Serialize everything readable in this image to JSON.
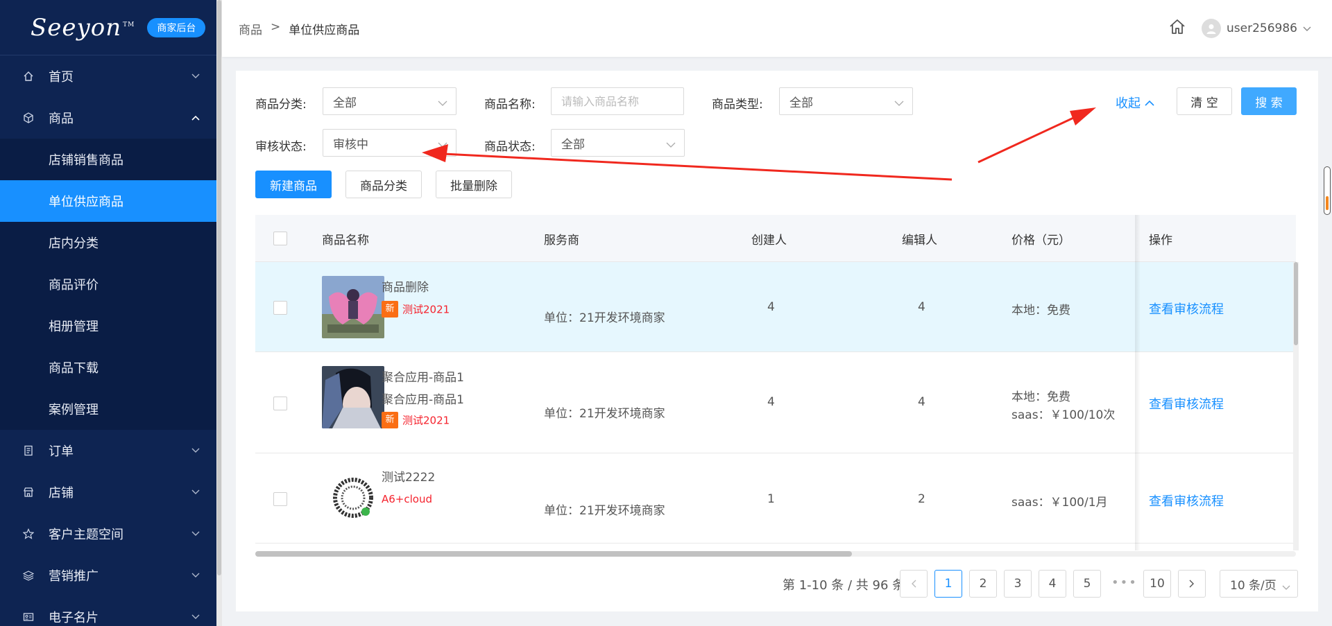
{
  "sidebar": {
    "brand": "Seeyon",
    "brand_tm": "TM",
    "badge": "商家后台",
    "items": [
      {
        "label": "首页",
        "icon": "home-icon"
      },
      {
        "label": "商品",
        "icon": "cube-icon"
      },
      {
        "label": "订单",
        "icon": "order-icon"
      },
      {
        "label": "店铺",
        "icon": "store-icon"
      },
      {
        "label": "客户主题空间",
        "icon": "star-icon"
      },
      {
        "label": "营销推广",
        "icon": "layers-icon"
      },
      {
        "label": "电子名片",
        "icon": "card-icon"
      }
    ],
    "sub_items": [
      "店铺销售商品",
      "单位供应商品",
      "店内分类",
      "商品评价",
      "相册管理",
      "商品下载",
      "案例管理"
    ],
    "active_sub": "单位供应商品"
  },
  "header": {
    "breadcrumb": [
      "商品",
      ">",
      "单位供应商品"
    ],
    "username": "user256986"
  },
  "filters": {
    "category_label": "商品分类:",
    "category_value": "全部",
    "name_label": "商品名称:",
    "name_placeholder": "请输入商品名称",
    "type_label": "商品类型:",
    "type_value": "全部",
    "audit_label": "审核状态:",
    "audit_value": "审核中",
    "status_label": "商品状态:",
    "status_value": "全部",
    "collapse": "收起",
    "clear": "清 空",
    "search": "搜 索"
  },
  "actions": {
    "new": "新建商品",
    "category": "商品分类",
    "batch_delete": "批量删除"
  },
  "table": {
    "headers": {
      "name": "商品名称",
      "provider": "服务商",
      "creator": "创建人",
      "editor": "编辑人",
      "price": "价格（元）",
      "ops": "操作"
    },
    "rows": [
      {
        "names": [
          "商品删除"
        ],
        "tag_new": "新",
        "tag_text": "测试2021",
        "provider": "单位：21开发环境商家",
        "creator": "4",
        "editor": "4",
        "prices": [
          "本地：免费"
        ],
        "op": "查看审核流程"
      },
      {
        "names": [
          "聚合应用-商品1",
          "聚合应用-商品1"
        ],
        "tag_new": "新",
        "tag_text": "测试2021",
        "provider": "单位：21开发环境商家",
        "creator": "4",
        "editor": "4",
        "prices": [
          "本地：免费",
          "saas：￥100/10次"
        ],
        "op": "查看审核流程"
      },
      {
        "names": [
          "测试2222"
        ],
        "tag_new": "",
        "tag_text": "A6+cloud",
        "provider": "单位：21开发环境商家",
        "creator": "1",
        "editor": "2",
        "prices": [
          "saas：￥100/1月"
        ],
        "op": "查看审核流程"
      }
    ]
  },
  "pagination": {
    "total": "第 1-10 条 / 共 96 条",
    "pages": [
      "1",
      "2",
      "3",
      "4",
      "5"
    ],
    "dots": "•••",
    "last": "10",
    "page_size": "10 条/页",
    "prev": "<",
    "next": ">"
  },
  "colors": {
    "sidebar_bg": "#0e2452",
    "accent": "#1890ff",
    "tag_orange": "#fa6e14",
    "tag_red": "#f5222d",
    "row_highlight": "#e6f7fe",
    "annotation_red": "#f0281e"
  }
}
